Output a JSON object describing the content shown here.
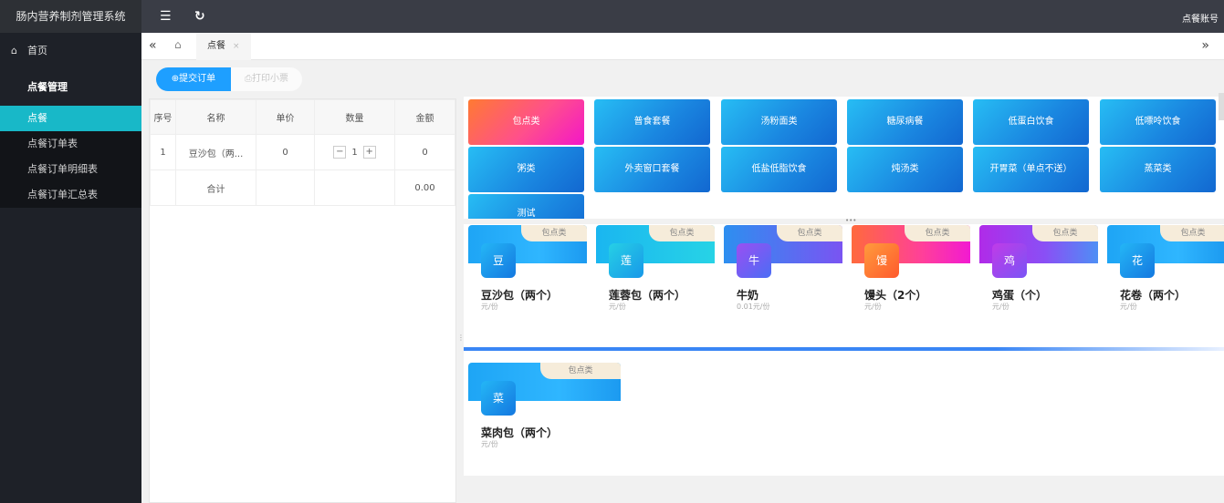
{
  "sidebar": {
    "title": "肠内营养制剂管理系统",
    "home_label": "首页",
    "group_label": "点餐管理",
    "items": [
      {
        "label": "点餐"
      },
      {
        "label": "点餐订单表"
      },
      {
        "label": "点餐订单明细表"
      },
      {
        "label": "点餐订单汇总表"
      }
    ]
  },
  "header": {
    "account_label": "点餐账号"
  },
  "tabbar": {
    "active_tab": "点餐",
    "close_label": "×"
  },
  "toolbar": {
    "submit_label": "⊕提交订单",
    "print_label": "⎙打印小票"
  },
  "order_table": {
    "columns": [
      "序号",
      "名称",
      "单价",
      "数量",
      "金额"
    ],
    "rows": [
      {
        "index": "1",
        "name": "豆沙包（两...",
        "price": "0",
        "qty": "1",
        "amount": "0"
      }
    ],
    "total_label": "合计",
    "total_amount": "0.00",
    "minus_label": "−",
    "plus_label": "+"
  },
  "categories": [
    {
      "label": "包点类"
    },
    {
      "label": "普食套餐"
    },
    {
      "label": "汤粉面类"
    },
    {
      "label": "糖尿病餐"
    },
    {
      "label": "低蛋白饮食"
    },
    {
      "label": "低嘌呤饮食"
    },
    {
      "label": "粥类"
    },
    {
      "label": "外卖窗口套餐"
    },
    {
      "label": "低盐低脂饮食"
    },
    {
      "label": "炖汤类"
    },
    {
      "label": "开胃菜（单点不送）"
    },
    {
      "label": "蒸菜类"
    },
    {
      "label": "测试"
    }
  ],
  "products": [
    {
      "tag": "包点类",
      "icon_char": "豆",
      "name": "豆沙包（两个）",
      "price": "元/份",
      "band": "blue",
      "icon": "blue"
    },
    {
      "tag": "包点类",
      "icon_char": "莲",
      "name": "莲蓉包（两个）",
      "price": "元/份",
      "band": "cyan",
      "icon": "cyan"
    },
    {
      "tag": "包点类",
      "icon_char": "牛",
      "name": "牛奶",
      "price": "0.01元/份",
      "band": "purple",
      "icon": "purple"
    },
    {
      "tag": "包点类",
      "icon_char": "馒",
      "name": "馒头（2个）",
      "price": "元/份",
      "band": "pink",
      "icon": "orange"
    },
    {
      "tag": "包点类",
      "icon_char": "鸡",
      "name": "鸡蛋（个）",
      "price": "元/份",
      "band": "violet",
      "icon": "violet"
    },
    {
      "tag": "包点类",
      "icon_char": "花",
      "name": "花卷（两个）",
      "price": "元/份",
      "band": "blue",
      "icon": "blue"
    },
    {
      "tag": "包点类",
      "icon_char": "菜",
      "name": "菜肉包（两个）",
      "price": "元/份",
      "band": "blue",
      "icon": "blue"
    }
  ],
  "colors": {
    "accent": "#1e9fff",
    "sidebar_active": "#18b8c8",
    "sidebar_bg": "#1e2128",
    "header_bg": "#3a3d46"
  }
}
